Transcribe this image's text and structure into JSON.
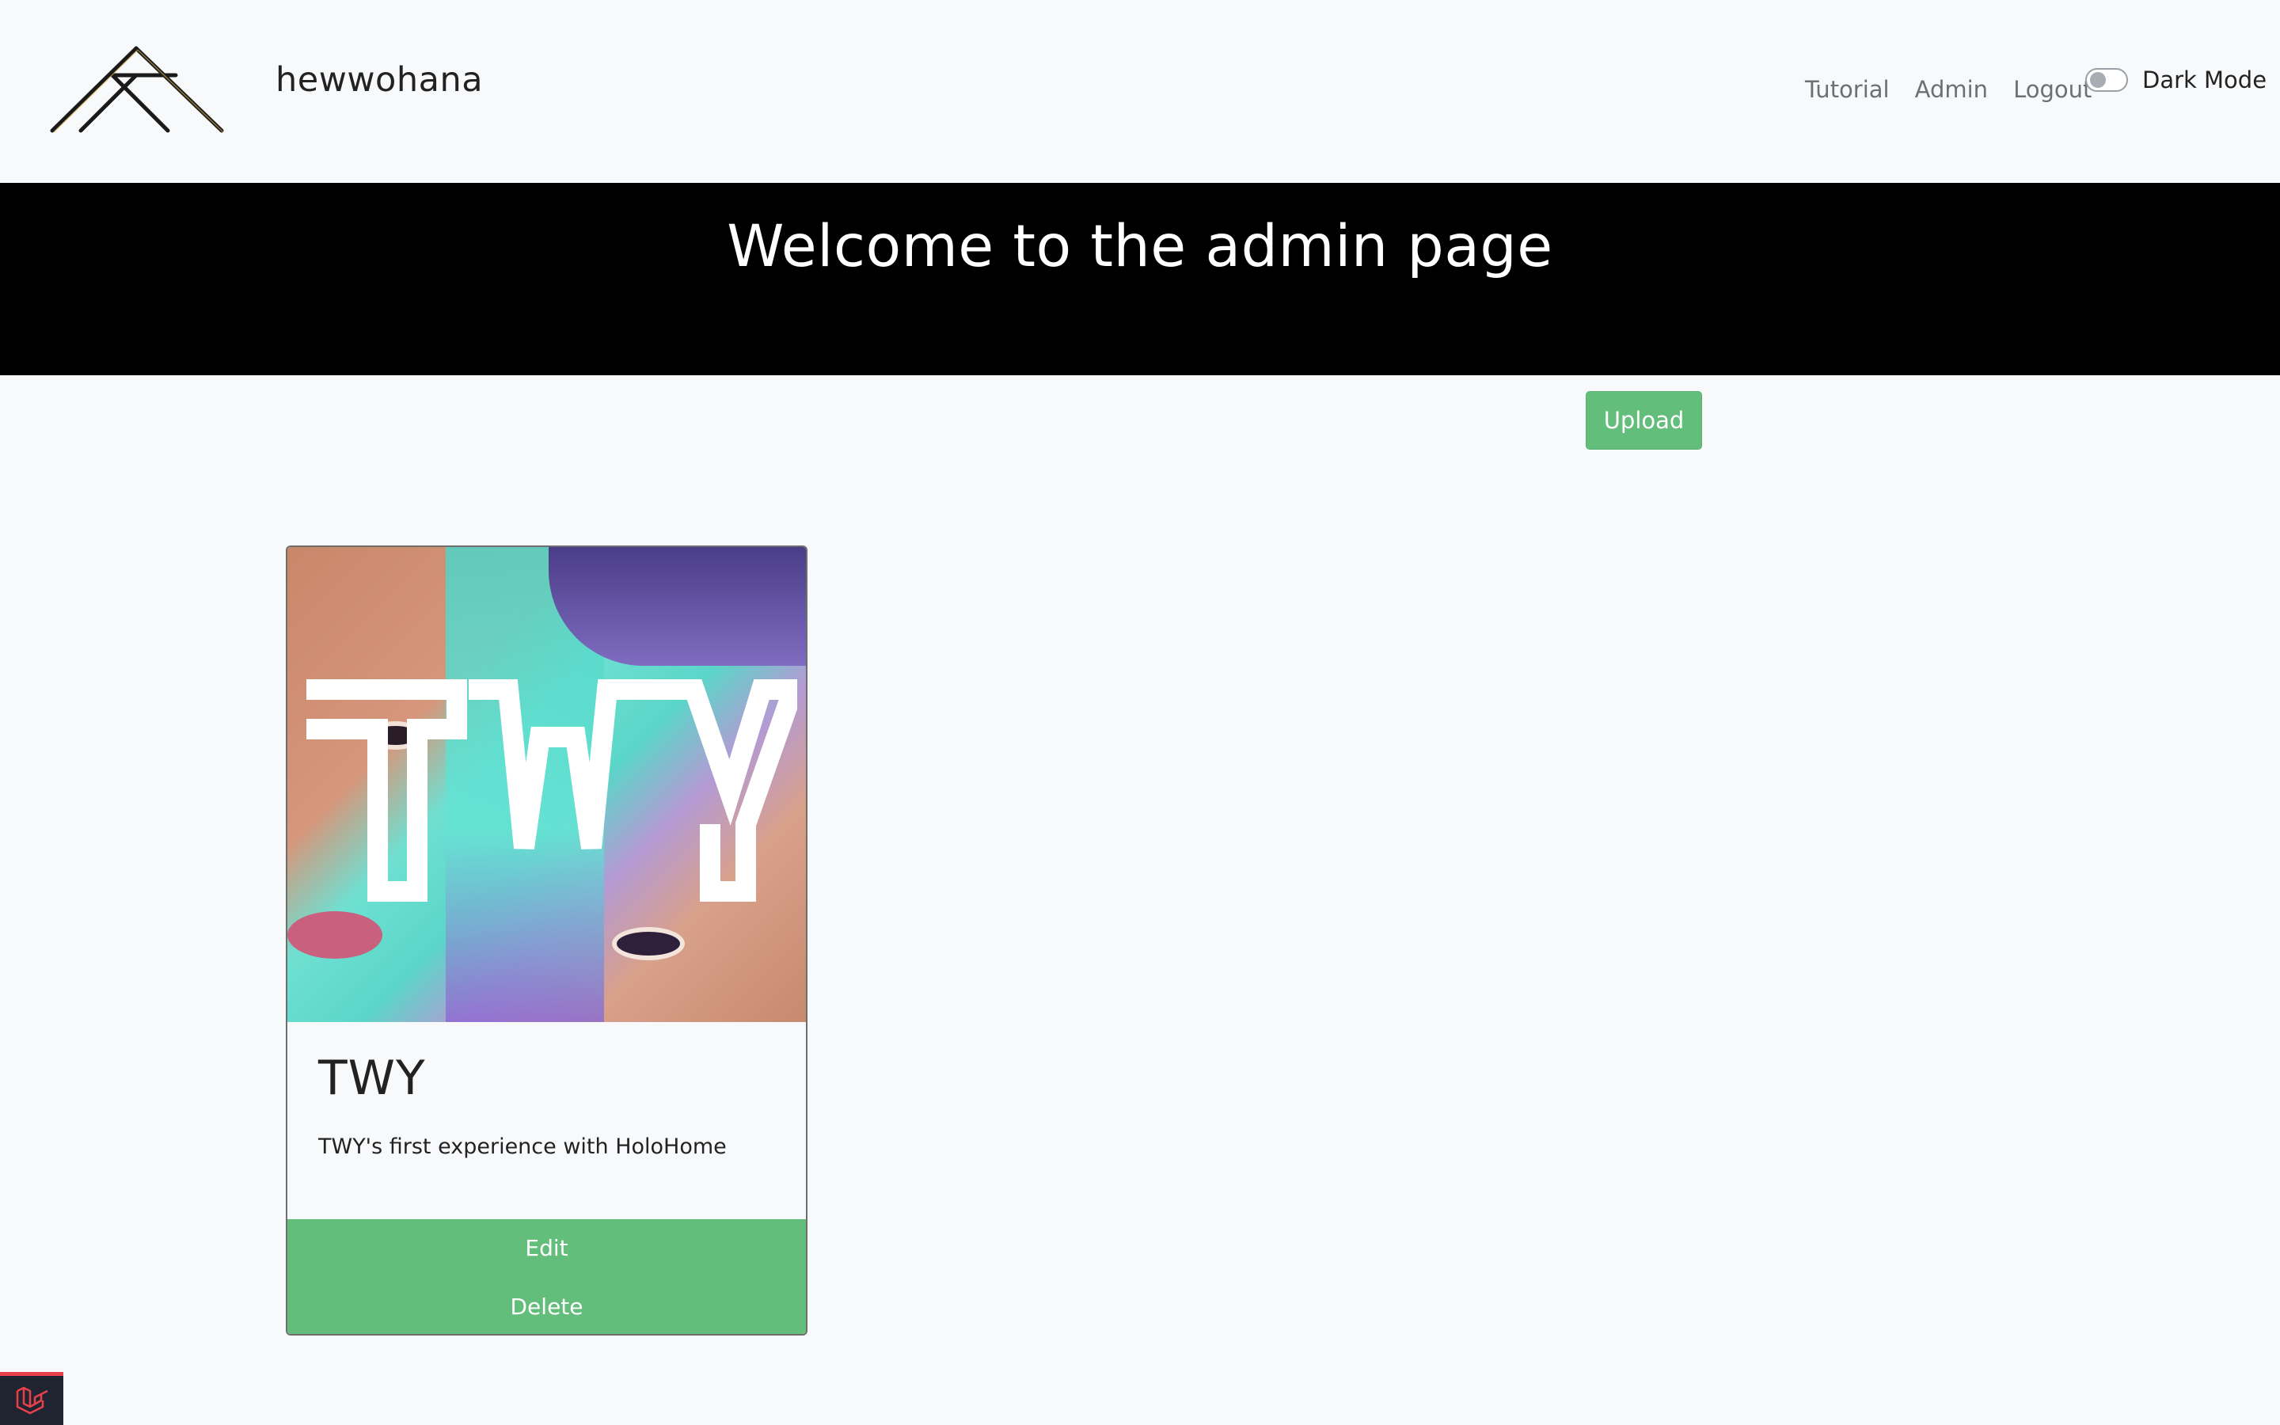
{
  "brand": {
    "name": "hewwohana"
  },
  "nav": {
    "links": [
      "Tutorial",
      "Admin",
      "Logout"
    ],
    "dark_mode_label": "Dark Mode",
    "dark_mode_on": false
  },
  "hero": {
    "title": "Welcome to the admin page"
  },
  "toolbar": {
    "upload_label": "Upload"
  },
  "cards": [
    {
      "title": "TWY",
      "description": "TWY's first experience with HoloHome",
      "edit_label": "Edit",
      "delete_label": "Delete"
    }
  ],
  "colors": {
    "accent_green": "#63be7b",
    "hero_bg": "#000000",
    "page_bg": "#f8f9fb"
  },
  "icons": {
    "logo": "mountain-lines-logo",
    "debug": "laravel-icon"
  }
}
